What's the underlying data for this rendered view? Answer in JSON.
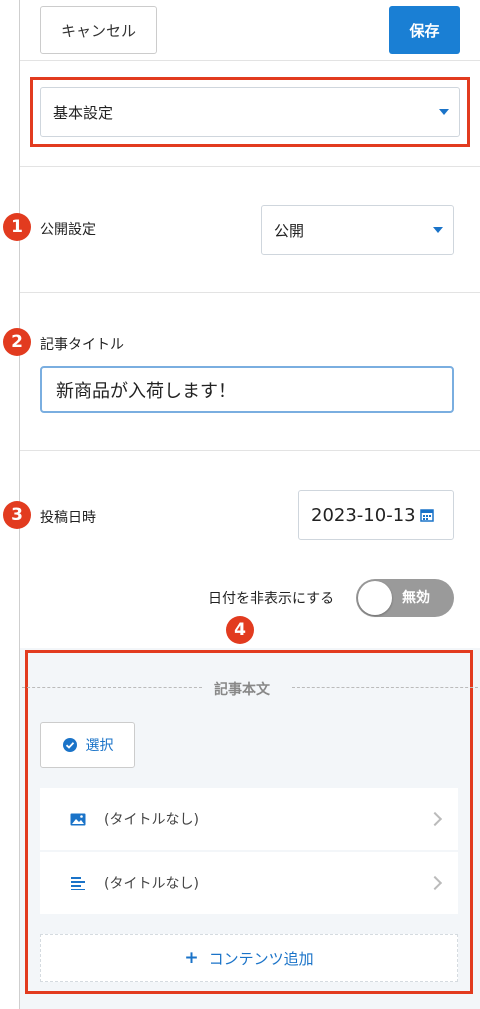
{
  "toolbar": {
    "cancel_label": "キャンセル",
    "save_label": "保存"
  },
  "settings_select": {
    "value": "基本設定"
  },
  "publish": {
    "marker": "1",
    "label": "公開設定",
    "value": "公開"
  },
  "title_field": {
    "marker": "2",
    "label": "記事タイトル",
    "value": "新商品が入荷します！"
  },
  "post_date": {
    "marker": "3",
    "label": "投稿日時",
    "value": "2023-10-13"
  },
  "hide_date": {
    "label": "日付を非表示にする",
    "toggle_text": "無効"
  },
  "article_body": {
    "marker": "4",
    "heading": "記事本文",
    "select_label": "選択",
    "items": [
      {
        "icon": "image-icon",
        "label": "(タイトルなし)"
      },
      {
        "icon": "text-icon",
        "label": "(タイトルなし)"
      }
    ],
    "add_label": "コンテンツ追加"
  },
  "colors": {
    "accent": "#1a7fd4",
    "annotation": "#e23b1f",
    "toggle_off": "#9a9a9a"
  }
}
